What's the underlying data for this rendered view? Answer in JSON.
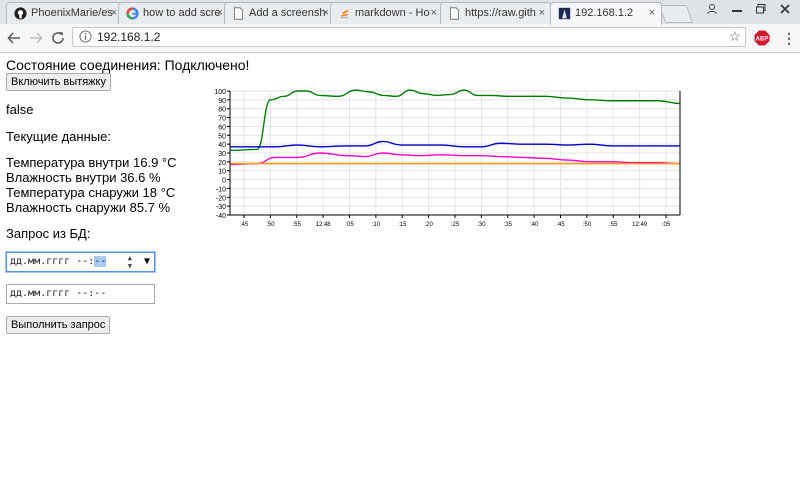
{
  "browser": {
    "tabs": [
      {
        "label": "PhoenixMarie/es"
      },
      {
        "label": "how to add scre"
      },
      {
        "label": "Add a screensh"
      },
      {
        "label": "markdown - Ho"
      },
      {
        "label": "https://raw.gith"
      },
      {
        "label": "192.168.1.2"
      }
    ],
    "close_glyph": "×",
    "url": "192.168.1.2",
    "abp_label": "ABP"
  },
  "page": {
    "status_text": "Состояние соединения: Подключено!",
    "hood_button": "Включить вытяжку",
    "flag_text": "false",
    "current_heading": "Текущие данные:",
    "readings": [
      "Температура внутри 16.9 °C",
      "Влажность внутри 36.6 %",
      "Температура снаружи 18 °C",
      "Влажность снаружи 85.7 %"
    ],
    "query_label": "Запрос из БД:",
    "from_input": {
      "text": "дд.мм.гггг --:",
      "selected": "--"
    },
    "to_input": {
      "text": "дд.мм.гггг --:--"
    },
    "run_button": "Выполнить запрос"
  },
  "chart_data": {
    "type": "line",
    "ylim": [
      -40,
      100
    ],
    "yticks": [
      -40,
      -30,
      -20,
      -10,
      0,
      10,
      20,
      30,
      40,
      50,
      60,
      70,
      80,
      90,
      100
    ],
    "xticks": [
      ":45",
      ":50",
      ":55",
      "12:48",
      ":05",
      ":10",
      ":15",
      ":20",
      ":25",
      ":30",
      ":35",
      ":40",
      ":45",
      ":50",
      ":55",
      "12:49",
      ":05"
    ],
    "grid": true,
    "series": [
      {
        "color": "#008000",
        "x": [
          0,
          0.06,
          0.09,
          0.12,
          0.15,
          0.17,
          0.2,
          0.24,
          0.28,
          0.31,
          0.34,
          0.37,
          0.4,
          0.43,
          0.46,
          0.49,
          0.52,
          0.55,
          0.58,
          0.62,
          0.66,
          0.7,
          0.75,
          0.8,
          0.85,
          0.9,
          0.95,
          1
        ],
        "values": [
          33,
          34,
          90,
          94,
          100,
          100,
          95,
          94,
          101,
          99,
          95,
          94,
          101,
          97,
          95,
          96,
          101,
          95,
          95,
          94,
          94,
          94,
          92,
          90,
          89,
          89,
          89,
          86
        ]
      },
      {
        "color": "#0000cc",
        "x": [
          0,
          0.06,
          0.1,
          0.15,
          0.2,
          0.26,
          0.3,
          0.34,
          0.38,
          0.42,
          0.47,
          0.52,
          0.56,
          0.6,
          0.65,
          0.7,
          0.75,
          0.8,
          0.85,
          0.9,
          0.95,
          1
        ],
        "values": [
          37,
          37,
          37,
          39,
          37,
          38,
          38,
          43,
          39,
          39,
          39,
          37,
          37,
          41,
          40,
          40,
          39,
          40,
          38,
          38,
          38,
          38
        ]
      },
      {
        "color": "#ff00cc",
        "x": [
          0,
          0.06,
          0.1,
          0.15,
          0.2,
          0.26,
          0.3,
          0.34,
          0.38,
          0.42,
          0.47,
          0.52,
          0.56,
          0.6,
          0.65,
          0.7,
          0.75,
          0.8,
          0.85,
          0.9,
          0.95,
          1
        ],
        "values": [
          17,
          18,
          25,
          25,
          30,
          27,
          26,
          30,
          28,
          27,
          28,
          27,
          27,
          26,
          25,
          24,
          22,
          20,
          20,
          19,
          19,
          18
        ]
      },
      {
        "color": "#ff9900",
        "x": [
          0,
          1
        ],
        "values": [
          18,
          18
        ]
      }
    ]
  }
}
